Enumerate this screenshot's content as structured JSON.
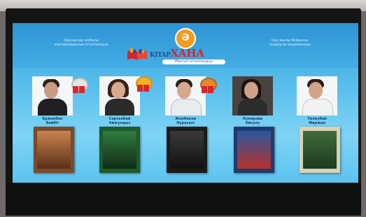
{
  "header": {
    "left_text": "Оқушылар жобасы\nшығармашылық кітапханасы",
    "right_text": "Оқу жылы бойынша\nтаңдаулы оқырмандар",
    "logo_letter": "Ә",
    "logo_name_main": "KITAP",
    "logo_name_accent": "ХАНА",
    "logo_tagline": "Мектеп кітапханасы"
  },
  "students": [
    {
      "name": "Ержанбек\nБейбіт"
    },
    {
      "name": "Сарсенбай\nАйжұлдыз"
    },
    {
      "name": "Жанбеков\nНұрасыл"
    },
    {
      "name": "Кумарова\nАйсулу"
    },
    {
      "name": "Төлеубай\nМиржан"
    }
  ],
  "colors": {
    "screen_top": "#3aa3df",
    "screen_bottom": "#5cc3ef",
    "logo_orange": "#f39a1f",
    "logo_red": "#d0262e"
  }
}
